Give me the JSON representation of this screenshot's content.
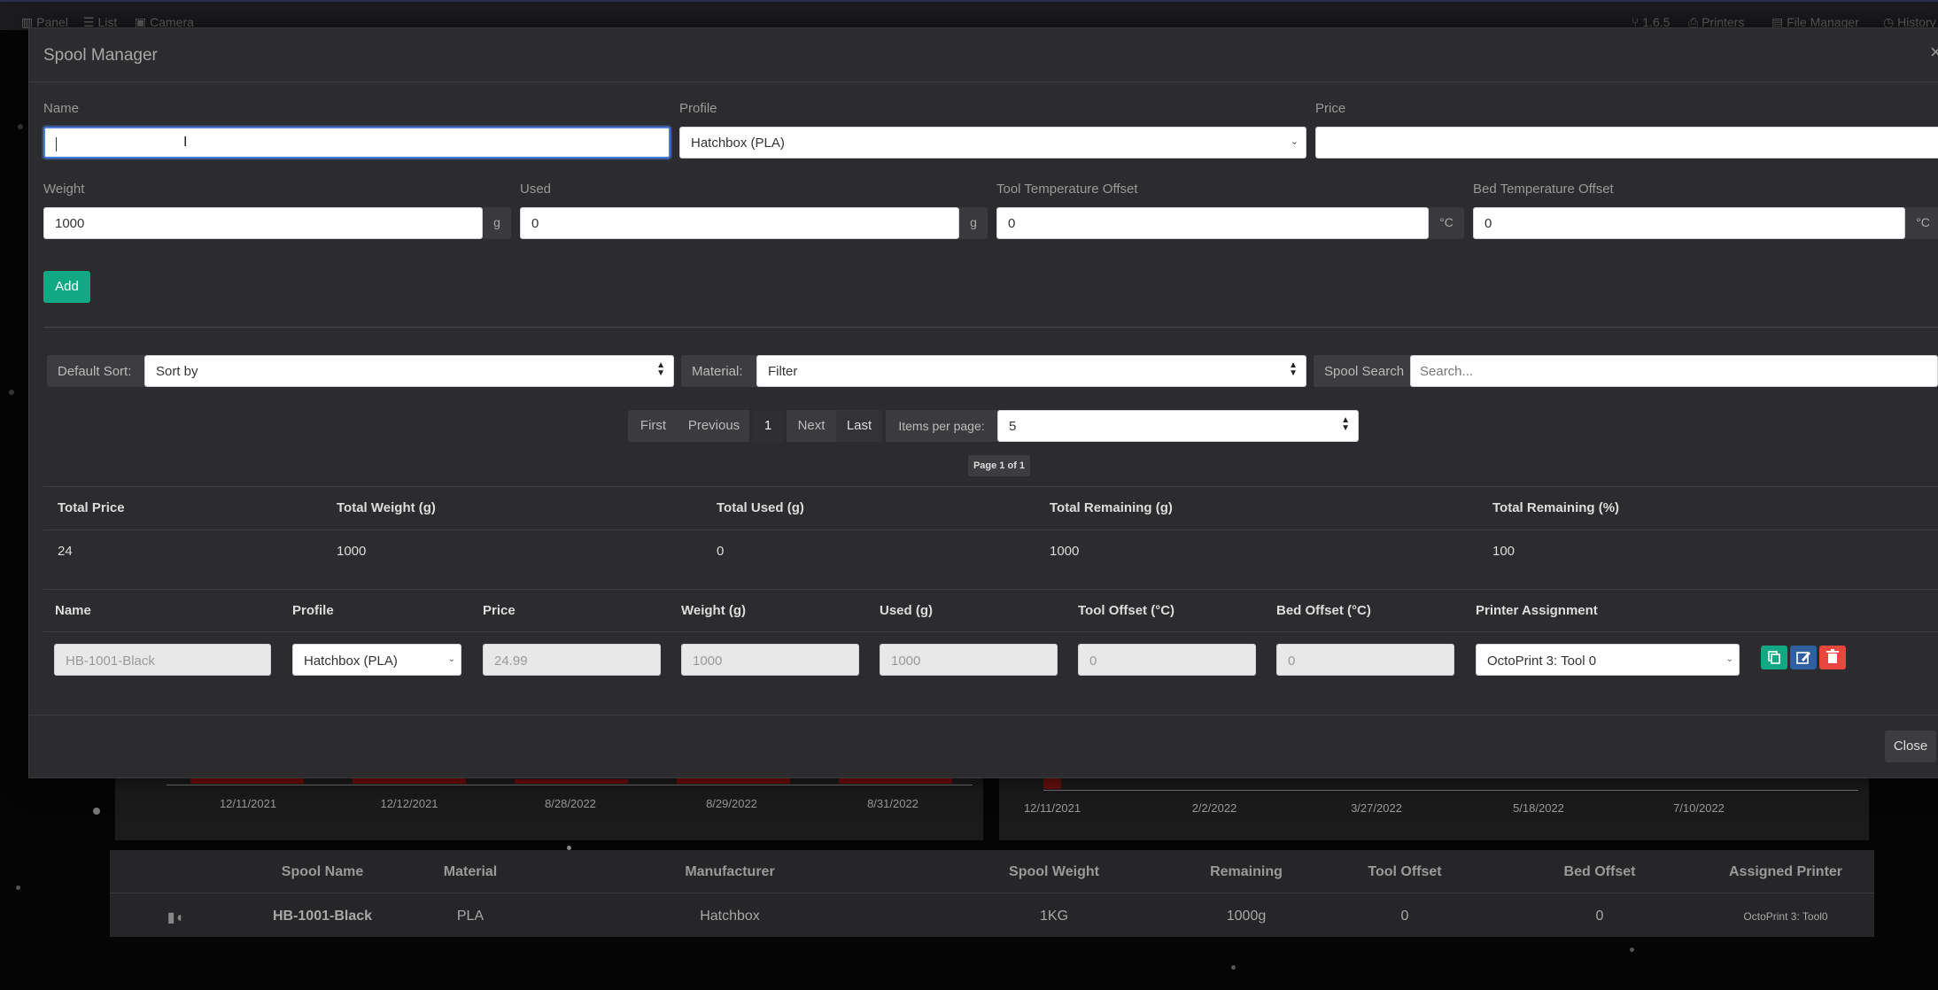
{
  "background": {
    "nav": {
      "panel": "Panel",
      "list": "List",
      "camera": "Camera",
      "version": "1.6.5",
      "printers": "Printers",
      "file_manager": "File Manager",
      "history": "History"
    },
    "chart1_dates": [
      "12/11/2021",
      "12/12/2021",
      "8/28/2022",
      "8/29/2022",
      "8/31/2022"
    ],
    "chart2_dates": [
      "12/11/2021",
      "2/2/2022",
      "3/27/2022",
      "5/18/2022",
      "7/10/2022"
    ],
    "table": {
      "headers": [
        "Spool Name",
        "Material",
        "Manufacturer",
        "Spool Weight",
        "Remaining",
        "Tool Offset",
        "Bed Offset",
        "Assigned Printer"
      ],
      "row": [
        "HB-1001-Black",
        "PLA",
        "Hatchbox",
        "1KG",
        "1000g",
        "0",
        "0",
        "OctoPrint 3: Tool0"
      ]
    }
  },
  "modal": {
    "title": "Spool Manager",
    "close_x": "×",
    "form": {
      "name_label": "Name",
      "name_value": "",
      "profile_label": "Profile",
      "profile_value": "Hatchbox (PLA)",
      "price_label": "Price",
      "price_value": "",
      "weight_label": "Weight",
      "weight_value": "1000",
      "weight_unit": "g",
      "used_label": "Used",
      "used_value": "0",
      "used_unit": "g",
      "tool_temp_label": "Tool Temperature Offset",
      "tool_temp_value": "0",
      "tool_temp_unit": "°C",
      "bed_temp_label": "Bed Temperature Offset",
      "bed_temp_value": "0",
      "bed_temp_unit": "°C",
      "add_label": "Add"
    },
    "filters": {
      "sort_label": "Default Sort:",
      "sort_value": "Sort by",
      "material_label": "Material:",
      "material_value": "Filter",
      "search_label": "Spool Search",
      "search_placeholder": "Search..."
    },
    "pagination": {
      "first": "First",
      "previous": "Previous",
      "current": "1",
      "next": "Next",
      "last": "Last",
      "per_page_label": "Items per page:",
      "per_page_value": "5",
      "page_info": "Page 1 of 1"
    },
    "totals": {
      "headers": [
        "Total Price",
        "Total Weight (g)",
        "Total Used (g)",
        "Total Remaining (g)",
        "Total Remaining (%)"
      ],
      "values": [
        "24",
        "1000",
        "0",
        "1000",
        "100"
      ]
    },
    "spools": {
      "headers": [
        "Name",
        "Profile",
        "Price",
        "Weight (g)",
        "Used (g)",
        "Tool Offset (°C)",
        "Bed Offset (°C)",
        "Printer Assignment"
      ],
      "row": {
        "name": "HB-1001-Black",
        "profile": "Hatchbox (PLA)",
        "price": "24.99",
        "weight": "1000",
        "used": "1000",
        "tool_offset": "0",
        "bed_offset": "0",
        "printer": "OctoPrint 3: Tool 0"
      }
    },
    "close_label": "Close"
  },
  "colors": {
    "add_button": "#13a884",
    "copy_button": "#13a884",
    "edit_button": "#2f5f9e",
    "delete_button": "#e7473c"
  }
}
